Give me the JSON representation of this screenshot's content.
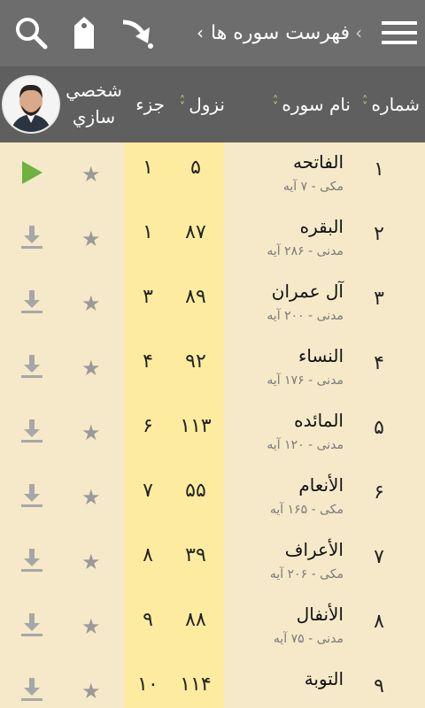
{
  "toolbar": {
    "title": "فهرست سوره ها",
    "chevron_left": "‹",
    "chevron_right": "‹",
    "icons": [
      "search-icon",
      "tag-icon",
      "arrow-down-icon",
      "hamburger-menu-icon"
    ]
  },
  "header": {
    "col_number": "شماره",
    "col_name": "نام سوره",
    "col_nozul": "نزول",
    "col_juz": "جزء",
    "personal_line1": "شخصي",
    "personal_line2": "سازي"
  },
  "colors": {
    "topbar": "#6d6d6d",
    "header": "#5f5f5f",
    "background": "#f6e9c9",
    "stripe": "#fdeca0",
    "sort_accent": "#b7d66a",
    "play": "#6db33f"
  },
  "surahs": [
    {
      "num": "۱",
      "name": "الفاتحه",
      "sub": "مکی - ۷ آیه",
      "nozul": "۵",
      "juz": "۱",
      "action": "play"
    },
    {
      "num": "۲",
      "name": "البقره",
      "sub": "مدنی - ۲۸۶ آیه",
      "nozul": "۸۷",
      "juz": "۱",
      "action": "download"
    },
    {
      "num": "۳",
      "name": "آل عمران",
      "sub": "مدنی - ۲۰۰ آیه",
      "nozul": "۸۹",
      "juz": "۳",
      "action": "download"
    },
    {
      "num": "۴",
      "name": "النساء",
      "sub": "مدنی - ۱۷۶ آیه",
      "nozul": "۹۲",
      "juz": "۴",
      "action": "download"
    },
    {
      "num": "۵",
      "name": "المائده",
      "sub": "مدنی - ۱۲۰ آیه",
      "nozul": "۱۱۳",
      "juz": "۶",
      "action": "download"
    },
    {
      "num": "۶",
      "name": "الأنعام",
      "sub": "مکی - ۱۶۵ آیه",
      "nozul": "۵۵",
      "juz": "۷",
      "action": "download"
    },
    {
      "num": "۷",
      "name": "الأعراف",
      "sub": "مکی - ۲۰۶ آیه",
      "nozul": "۳۹",
      "juz": "۸",
      "action": "download"
    },
    {
      "num": "۸",
      "name": "الأنفال",
      "sub": "مدنی - ۷۵ آیه",
      "nozul": "۸۸",
      "juz": "۹",
      "action": "download"
    },
    {
      "num": "۹",
      "name": "التوبة",
      "sub": "",
      "nozul": "۱۱۴",
      "juz": "۱۰",
      "action": "download"
    }
  ]
}
